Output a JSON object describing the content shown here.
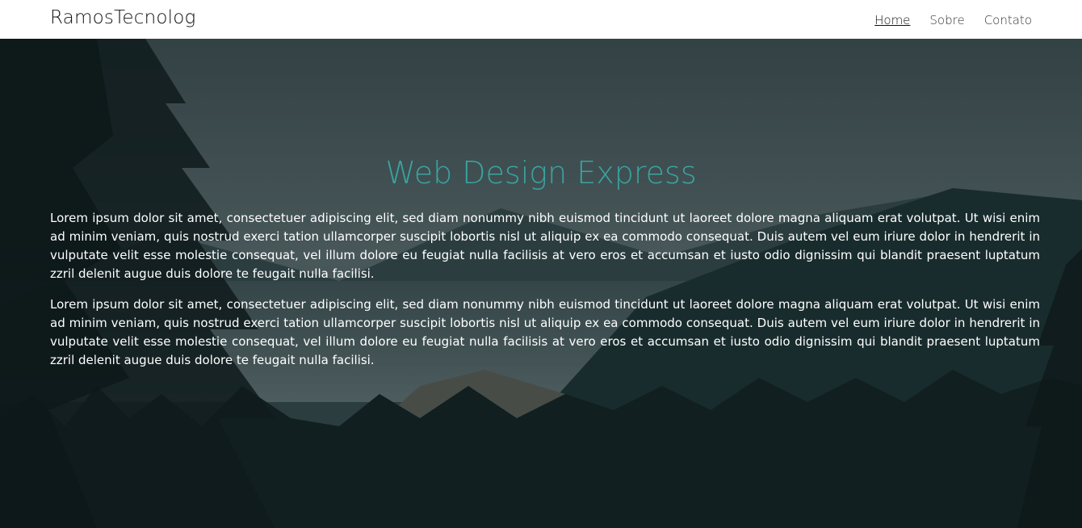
{
  "header": {
    "brand": "RamosTecnolog",
    "nav": [
      {
        "label": "Home",
        "active": true
      },
      {
        "label": "Sobre",
        "active": false
      },
      {
        "label": "Contato",
        "active": false
      }
    ]
  },
  "hero": {
    "title": "Web Design Express",
    "paragraphs": [
      "Lorem ipsum dolor sit amet, consectetuer adipiscing elit, sed diam nonummy nibh euismod tincidunt ut laoreet dolore magna aliquam erat volutpat. Ut wisi enim ad minim veniam, quis nostrud exerci tation ullamcorper suscipit lobortis nisl ut aliquip ex ea commodo consequat. Duis autem vel eum iriure dolor in hendrerit in vulputate velit esse molestie consequat, vel illum dolore eu feugiat nulla facilisis at vero eros et accumsan et iusto odio dignissim qui blandit praesent luptatum zzril delenit augue duis dolore te feugait nulla facilisi.",
      "Lorem ipsum dolor sit amet, consectetuer adipiscing elit, sed diam nonummy nibh euismod tincidunt ut laoreet dolore magna aliquam erat volutpat. Ut wisi enim ad minim veniam, quis nostrud exerci tation ullamcorper suscipit lobortis nisl ut aliquip ex ea commodo consequat. Duis autem vel eum iriure dolor in hendrerit in vulputate velit esse molestie consequat, vel illum dolore eu feugiat nulla facilisis at vero eros et accumsan et iusto odio dignissim qui blandit praesent luptatum zzril delenit augue duis dolore te feugait nulla facilisi."
    ]
  },
  "colors": {
    "accent": "#3aa3a0",
    "header_bg": "#ffffff",
    "text_light": "#ffffff"
  }
}
